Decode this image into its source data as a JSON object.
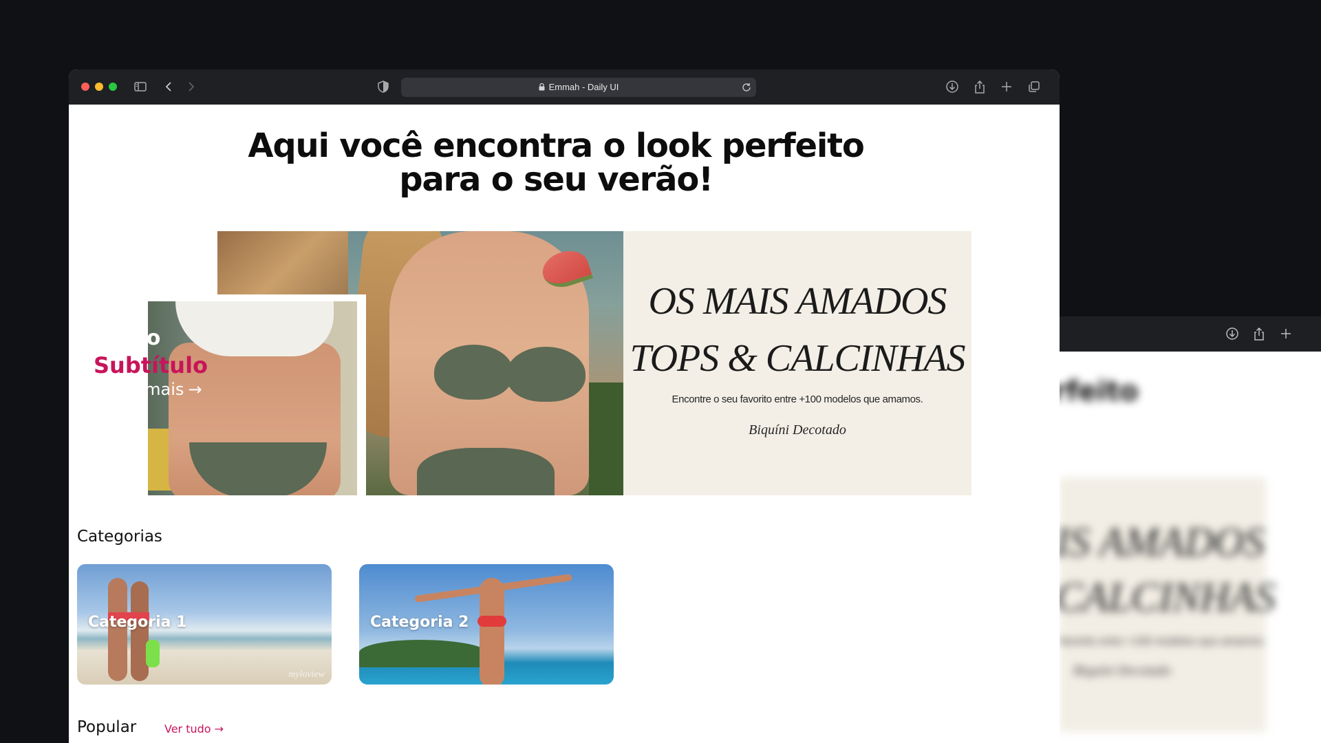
{
  "browser": {
    "url_title": "Emmah - Daily UI",
    "icons": [
      "sidebar-icon",
      "back-icon",
      "forward-icon",
      "shield-icon",
      "lock-icon",
      "reload-icon",
      "download-icon",
      "share-icon",
      "new-tab-icon",
      "tabs-overview-icon"
    ]
  },
  "page": {
    "hero_title_line1": "Aqui você encontra o look perfeito",
    "hero_title_line2": "para o seu verão!",
    "banner": {
      "overlay_title": "Título",
      "overlay_subtitle": "Subtítulo",
      "overlay_link": "Saiba mais",
      "overlay_link_arrow": "→",
      "panel_line1": "OS MAIS AMADOS",
      "panel_line2": "TOPS & CALCINHAS",
      "panel_subtitle": "Encontre o seu favorito entre +100 modelos que amamos.",
      "panel_link": "Biquíni Decotado"
    },
    "categories": {
      "title": "Categorias",
      "items": [
        {
          "label": "Categoria 1",
          "watermark": "myloview"
        },
        {
          "label": "Categoria 2"
        }
      ]
    },
    "popular": {
      "title": "Popular",
      "see_all": "Ver tudo",
      "see_all_arrow": "→"
    }
  },
  "background_window": {
    "heading_fragment": "rfeito",
    "panel_line1": "IS AMADOS",
    "panel_line2": "CALCINHAS",
    "panel_subtitle": "favorito entre +100 modelos que amamos.",
    "panel_link": "Biquíni Decotado"
  },
  "colors": {
    "accent": "#c8145a",
    "toolbar": "#1e2024",
    "backdrop": "#0f1114",
    "banner_panel": "#f3efe6"
  }
}
